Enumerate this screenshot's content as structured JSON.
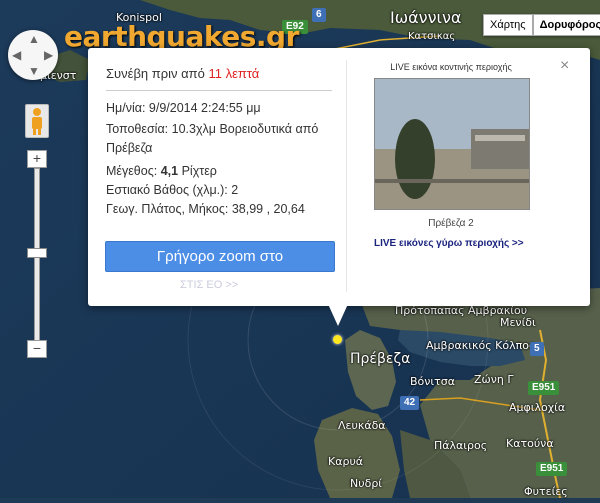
{
  "logo": "earthquakes.gr",
  "map_type": {
    "map_label": "Χάρτης",
    "satellite_label": "Δορυφόρος"
  },
  "place_labels": {
    "konispol": "Konispol",
    "ioannina": "Ιωάννινα",
    "katsikas": "Κατσικας",
    "left_partial": "μιενστ",
    "preveza": "Πρέβεζα",
    "ammoudia": "Αμμουδιά",
    "prot_amvrakiou": "Πρότοπαπας Αμβρακίου",
    "gulf": "Αμβρακικός Κόλπος",
    "menidi": "Μενίδι",
    "vonitsa": "Βόνιτσα",
    "zoni": "Ζώνη Γ",
    "amfilochia": "Αμφιλοχία",
    "lefkada": "Λευκάδα",
    "palairos": "Πάλαιρος",
    "katouna": "Κατούνα",
    "karya": "Καρυά",
    "nydri": "Νυδρί",
    "fytia": "Φυτείες"
  },
  "road_shields": {
    "e92": "E92",
    "r6": "6",
    "r5": "5",
    "e951a": "E951",
    "r42": "42",
    "e951b": "E951"
  },
  "popup": {
    "ago_prefix": "Συνέβη πριν από",
    "ago_value": "11 λεπτά",
    "date_label": "Ημ/νία:",
    "date_value": "9/9/2014 2:24:55 μμ",
    "location_label": "Τοποθεσία:",
    "location_value": "10.3χλμ Βορειοδυτικά από Πρέβεζα",
    "magnitude_label": "Μέγεθος:",
    "magnitude_value": "4,1",
    "magnitude_unit": "Ρίχτερ",
    "depth_label": "Εστιακό Βάθος (χλμ.):",
    "depth_value": "2",
    "coords_label": "Γεωγ. Πλάτος, Μήκος:",
    "coords_value": "38,99 , 20,64",
    "zoom_button": "Γρήγορο zoom στο",
    "more_link": "ΣΤΙΣ ΕΟ >>",
    "live_title": "LIVE εικόνα κοντινής περιοχής",
    "camera_name": "Πρέβεζα 2",
    "live_link": "LIVE εικόνες γύρω περιοχής >>",
    "close": "×"
  },
  "colors": {
    "earthquake_marker": "#ffe820",
    "ago_highlight": "#e02020",
    "zoom_button": "#4c8ee6",
    "logo": "#f0a830"
  }
}
